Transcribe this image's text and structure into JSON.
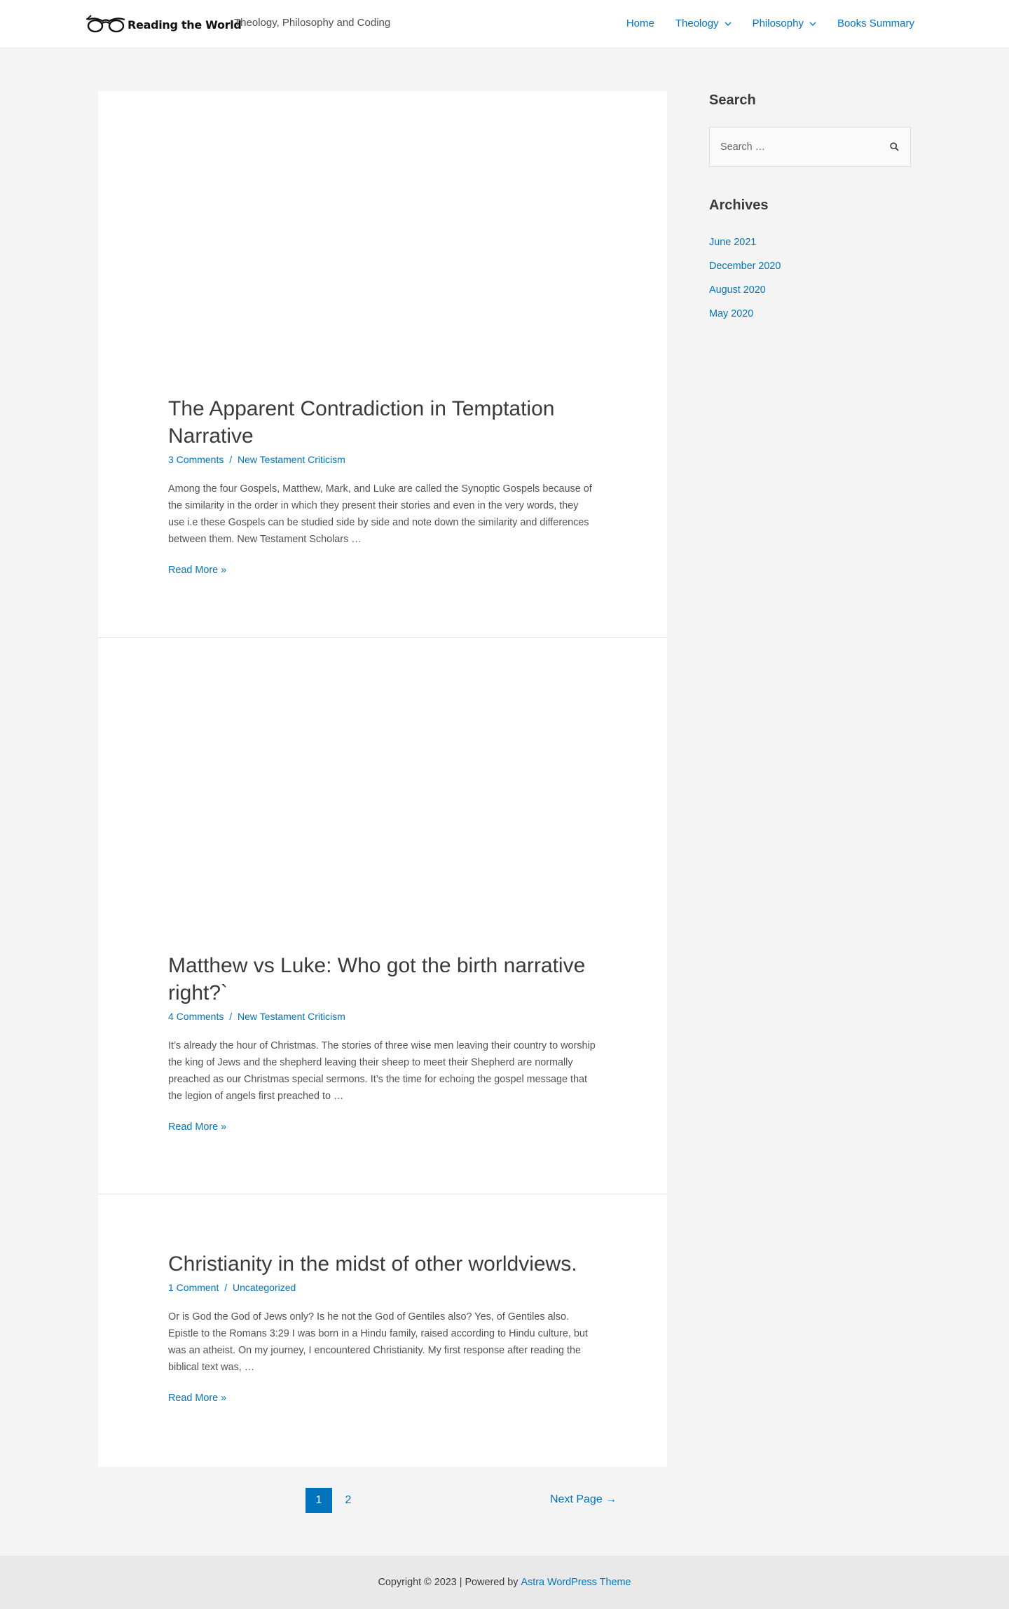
{
  "header": {
    "brand_name": "Reading the World",
    "tagline": "Theology, Philosophy and Coding",
    "nav": [
      {
        "label": "Home"
      },
      {
        "label": "Theology"
      },
      {
        "label": "Philosophy"
      },
      {
        "label": "Books Summary"
      }
    ]
  },
  "posts": [
    {
      "title": "The Apparent Contradiction in Temptation Narrative",
      "comments": "3 Comments",
      "meta_separator": "/",
      "category": "New Testament Criticism",
      "excerpt": "Among the four Gospels, Matthew, Mark, and Luke are called the Synoptic Gospels because of the similarity in the order in which they present their stories and even in the very words, they use i.e these Gospels can be studied side by side and note down the similarity and differences between them. New Testament Scholars …",
      "read_more": "Read More »"
    },
    {
      "title": "Matthew vs Luke: Who got the birth narrative right?`",
      "comments": "4 Comments",
      "meta_separator": "/",
      "category": "New Testament Criticism",
      "excerpt": "It’s already the hour of Christmas. The stories of three wise men leaving their country to worship the king of Jews and the shepherd leaving their sheep to meet their Shepherd are normally preached as our Christmas special sermons. It’s the time for echoing the gospel message that the legion of angels first preached to …",
      "read_more": "Read More »"
    },
    {
      "title": "Christianity in the midst of other worldviews.",
      "comments": "1 Comment",
      "meta_separator": "/",
      "category": "Uncategorized",
      "excerpt": "Or is God the God of Jews only? Is he not the God of Gentiles also? Yes, of Gentiles also. Epistle to the Romans 3:29 I was born in a Hindu family, raised according to Hindu culture, but was an atheist. On my journey, I encountered Christianity. My first response after reading the biblical text was, …",
      "read_more": "Read More »"
    }
  ],
  "pagination": {
    "pages": [
      "1",
      "2"
    ],
    "current": "1",
    "next_label": "Next Page →"
  },
  "sidebar": {
    "search_title": "Search",
    "search_placeholder": "Search …",
    "archives_title": "Archives",
    "archives": [
      "June 2021",
      "December 2020",
      "August 2020",
      "May 2020"
    ]
  },
  "footer": {
    "copyright": "Copyright © 2023 | Powered by",
    "theme_link": "Astra WordPress Theme"
  },
  "colors": {
    "accent": "#0274be",
    "background": "#f4f4f4",
    "card": "#ffffff",
    "text": "#3a3a3a",
    "footer_bg": "#e9e9e9"
  },
  "icons": {
    "logo": "glasses-icon",
    "dropdown": "chevron-down-icon",
    "search": "search-icon"
  }
}
